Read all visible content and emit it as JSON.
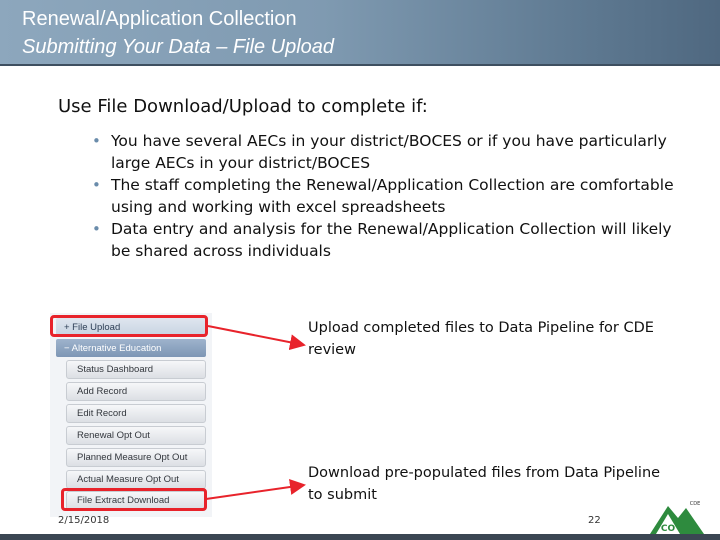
{
  "header": {
    "title_line1": "Renewal/Application Collection",
    "title_line2": "Submitting Your Data – File Upload"
  },
  "content": {
    "heading": "Use File Download/Upload to complete if:",
    "bullets": [
      "You have several AECs in your district/BOCES or if you have particularly large AECs in your district/BOCES",
      "The staff completing the Renewal/Application Collection are comfortable using and working with excel spreadsheets",
      "Data entry and analysis for the Renewal/Application Collection will likely be shared across individuals"
    ]
  },
  "menu": {
    "file_upload": "+ File Upload",
    "alt_education": "− Alternative Education",
    "items": [
      "Status Dashboard",
      "Add Record",
      "Edit Record",
      "Renewal Opt Out",
      "Planned Measure Opt Out",
      "Actual Measure Opt Out",
      "File Extract Download"
    ]
  },
  "notes": {
    "upload": "Upload completed files to Data Pipeline for CDE review",
    "download": "Download pre-populated files from Data Pipeline to submit"
  },
  "footer": {
    "date": "2/15/2018",
    "page": "22"
  },
  "logo": {
    "text": "CO",
    "small_text": "CDE"
  },
  "colors": {
    "highlight": "#e8232b",
    "logo_green": "#2e8b3e",
    "bullet": "#6a8cab"
  }
}
